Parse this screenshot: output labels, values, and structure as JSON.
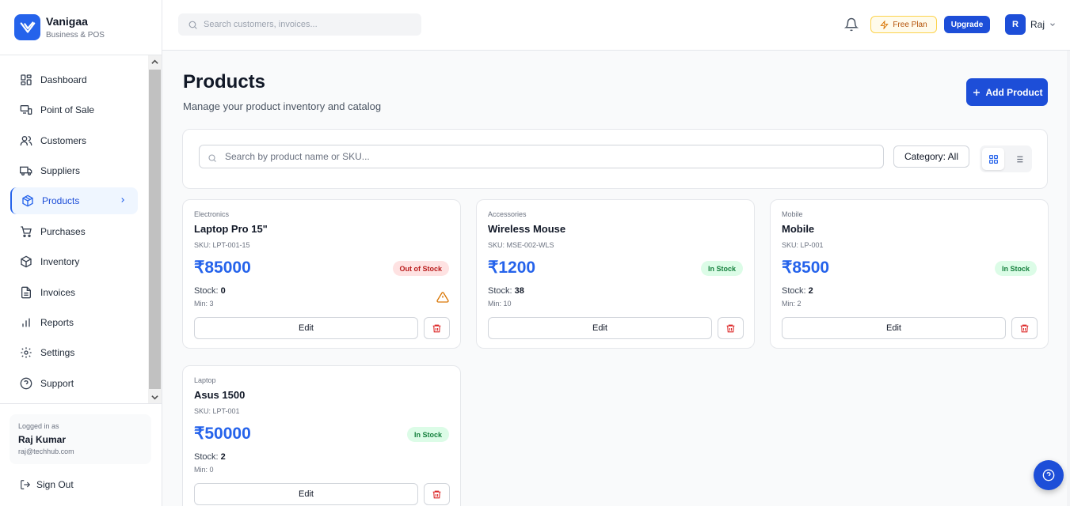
{
  "brand": {
    "name": "Vanigaa",
    "subtitle": "Business & POS"
  },
  "sidebar": {
    "items": [
      {
        "label": "Dashboard",
        "icon": "dashboard-icon"
      },
      {
        "label": "Point of Sale",
        "icon": "pos-icon"
      },
      {
        "label": "Customers",
        "icon": "users-icon"
      },
      {
        "label": "Suppliers",
        "icon": "truck-icon"
      },
      {
        "label": "Products",
        "icon": "package-icon",
        "active": true
      },
      {
        "label": "Purchases",
        "icon": "cart-icon"
      },
      {
        "label": "Inventory",
        "icon": "box-icon"
      },
      {
        "label": "Invoices",
        "icon": "file-icon"
      },
      {
        "label": "Reports",
        "icon": "bar-chart-icon"
      },
      {
        "label": "Settings",
        "icon": "gear-icon"
      },
      {
        "label": "Support",
        "icon": "help-circle-icon"
      }
    ],
    "logged_in_label": "Logged in as",
    "user_name": "Raj Kumar",
    "user_email": "raj@techhub.com",
    "sign_out": "Sign Out"
  },
  "header": {
    "search_placeholder": "Search customers, invoices...",
    "plan": "Free Plan",
    "upgrade": "Upgrade",
    "avatar_initial": "R",
    "user_short": "Raj"
  },
  "page": {
    "title": "Products",
    "subtitle": "Manage your product inventory and catalog",
    "add_button": "Add Product",
    "search_placeholder": "Search by product name or SKU...",
    "category_filter": "Category: All"
  },
  "products": [
    {
      "category": "Electronics",
      "name": "Laptop Pro 15\"",
      "sku": "SKU: LPT-001-15",
      "price": "₹85000",
      "status": "Out of Stock",
      "stock_label": "Stock: ",
      "stock": "0",
      "min": "Min: 3",
      "warning": true,
      "edit": "Edit"
    },
    {
      "category": "Accessories",
      "name": "Wireless Mouse",
      "sku": "SKU: MSE-002-WLS",
      "price": "₹1200",
      "status": "In Stock",
      "stock_label": "Stock: ",
      "stock": "38",
      "min": "Min: 10",
      "warning": false,
      "edit": "Edit"
    },
    {
      "category": "Mobile",
      "name": "Mobile",
      "sku": "SKU: LP-001",
      "price": "₹8500",
      "status": "In Stock",
      "stock_label": "Stock: ",
      "stock": "2",
      "min": "Min: 2",
      "warning": false,
      "edit": "Edit"
    },
    {
      "category": "Laptop",
      "name": "Asus 1500",
      "sku": "SKU: LPT-001",
      "price": "₹50000",
      "status": "In Stock",
      "stock_label": "Stock: ",
      "stock": "2",
      "min": "Min: 0",
      "warning": false,
      "edit": "Edit"
    }
  ],
  "colors": {
    "accent": "#1d4ed8",
    "in_stock_bg": "#dcfce7",
    "out_stock_bg": "#fee2e2"
  }
}
